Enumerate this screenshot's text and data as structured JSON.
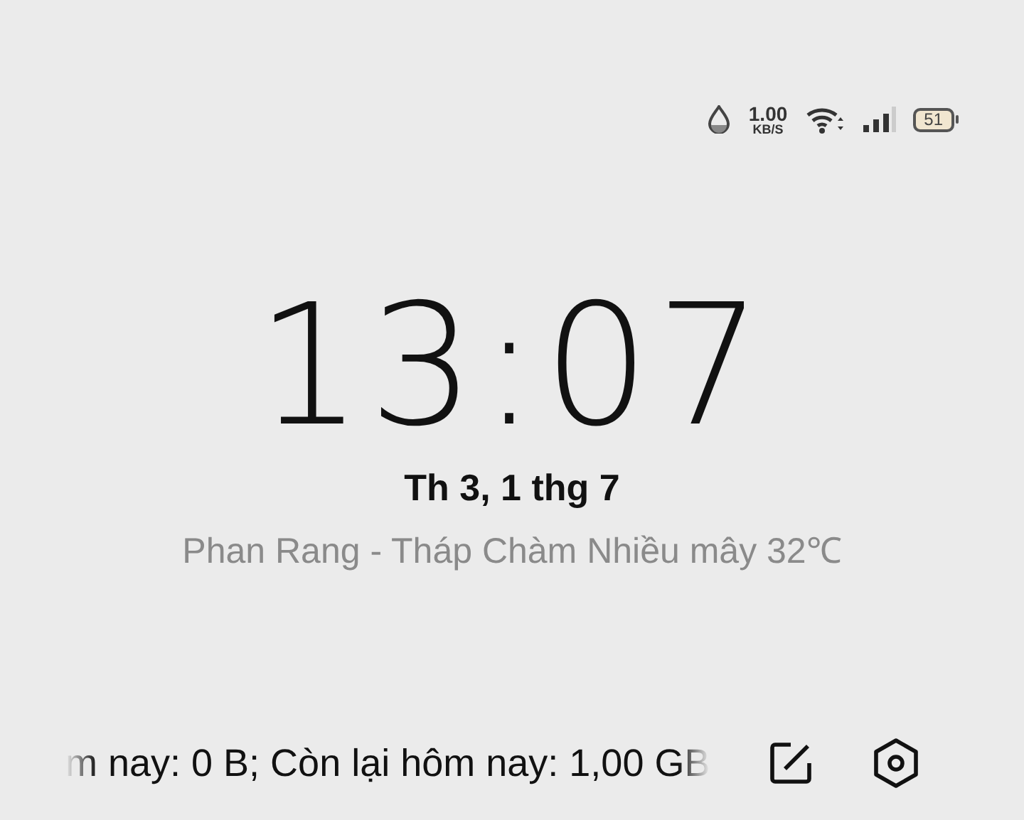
{
  "status_bar": {
    "net_speed": "1.00",
    "net_unit": "KB/S",
    "battery": "51"
  },
  "clock": {
    "time": "13:07",
    "date": "Th 3, 1 thg 7",
    "weather": "Phan Rang - Tháp Chàm Nhiều mây 32℃"
  },
  "bottom": {
    "ticker": "m nay: 0 B; Còn lại hôm nay: 1,00 GB"
  }
}
